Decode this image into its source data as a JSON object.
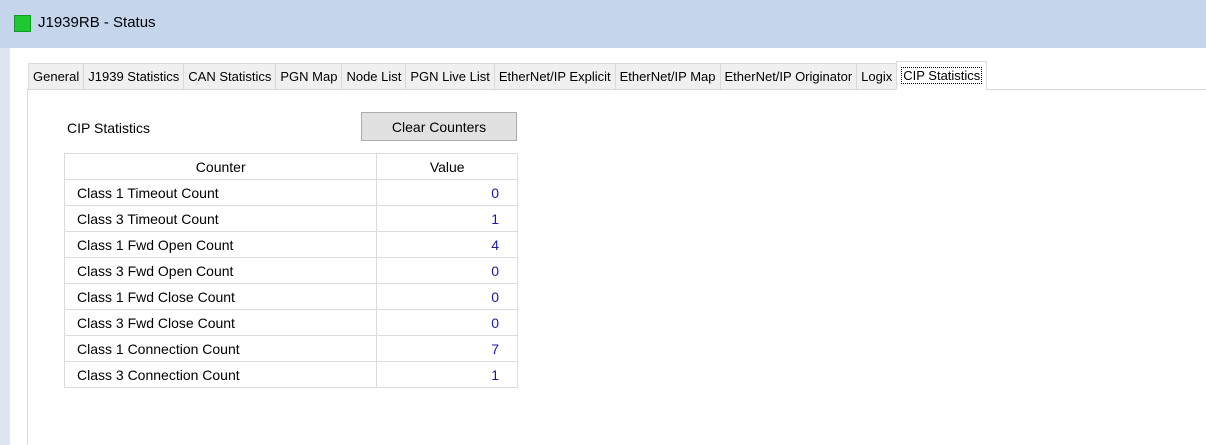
{
  "window": {
    "title": "J1939RB - Status",
    "colors": {
      "titlebar": "#c5d6ec",
      "status_icon": "#1fc832",
      "value_text": "#1a1aa8"
    }
  },
  "tabs": [
    {
      "label": "General",
      "active": false
    },
    {
      "label": "J1939 Statistics",
      "active": false
    },
    {
      "label": "CAN Statistics",
      "active": false
    },
    {
      "label": "PGN Map",
      "active": false
    },
    {
      "label": "Node List",
      "active": false
    },
    {
      "label": "PGN Live List",
      "active": false
    },
    {
      "label": "EtherNet/IP Explicit",
      "active": false
    },
    {
      "label": "EtherNet/IP Map",
      "active": false
    },
    {
      "label": "EtherNet/IP Originator",
      "active": false
    },
    {
      "label": "Logix",
      "active": false
    },
    {
      "label": "CIP Statistics",
      "active": true
    }
  ],
  "panel": {
    "section_label": "CIP Statistics",
    "clear_button_label": "Clear Counters",
    "table": {
      "columns": [
        "Counter",
        "Value"
      ],
      "rows": [
        {
          "counter": "Class 1 Timeout Count",
          "value": "0"
        },
        {
          "counter": "Class 3 Timeout Count",
          "value": "1"
        },
        {
          "counter": "Class 1 Fwd Open Count",
          "value": "4"
        },
        {
          "counter": "Class 3 Fwd Open Count",
          "value": "0"
        },
        {
          "counter": "Class 1 Fwd Close Count",
          "value": "0"
        },
        {
          "counter": "Class 3 Fwd Close Count",
          "value": "0"
        },
        {
          "counter": "Class 1 Connection Count",
          "value": "7"
        },
        {
          "counter": "Class 3 Connection Count",
          "value": "1"
        }
      ]
    }
  }
}
